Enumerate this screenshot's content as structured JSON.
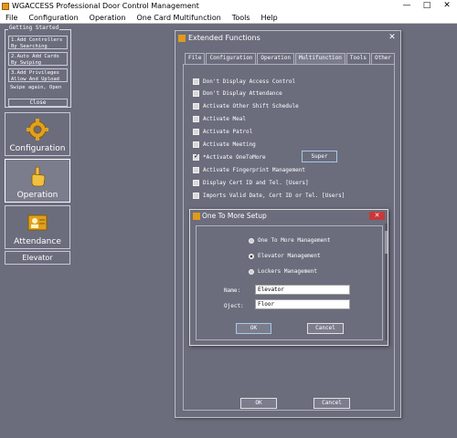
{
  "window": {
    "title": "WGACCESS Professional Door Control Management",
    "minimize": "—",
    "maximize": "□",
    "close": "✕"
  },
  "menu": [
    "File",
    "Configuration",
    "Operation",
    "One Card Multifunction",
    "Tools",
    "Help"
  ],
  "getting_started": {
    "legend": "Getting Started",
    "items": [
      "1.Add Controllers By Searching",
      "2.Auto Add Cards By Swiping",
      "3.Add Privileges Allow And Upload",
      "Swipe again, Open"
    ],
    "close": "Close"
  },
  "nav": [
    {
      "label": "Configuration",
      "icon": "gear-icon"
    },
    {
      "label": "Operation",
      "icon": "hand-pointer-icon"
    },
    {
      "label": "Attendance",
      "icon": "attendance-icon"
    },
    {
      "label": "Elevator"
    }
  ],
  "extended": {
    "title": "Extended Functions",
    "close": "✕",
    "tabs": [
      "File",
      "Configuration",
      "Operation",
      "Multifunction",
      "Tools",
      "Other"
    ],
    "active_tab": "Multifunction",
    "options": [
      {
        "label": "Don't Display Access Control",
        "checked": false
      },
      {
        "label": "Don't Display Attendance",
        "checked": false
      },
      {
        "label": "Activate Other Shift Schedule",
        "checked": false
      },
      {
        "label": "Activate Meal",
        "checked": false
      },
      {
        "label": "Activate Patrol",
        "checked": false
      },
      {
        "label": "Activate Meeting",
        "checked": false
      },
      {
        "label": "*Activate OneToMore",
        "checked": true
      },
      {
        "label": "Activate Fingerprint Management",
        "checked": false
      },
      {
        "label": "Display Cert ID and Tel. [Users]",
        "checked": false
      },
      {
        "label": "Imports Valid Date,  Cert ID or Tel. [Users]",
        "checked": false
      }
    ],
    "super_button": "Super",
    "ok": "OK",
    "cancel": "Cancel"
  },
  "one_to_more": {
    "title": "One To More Setup",
    "close": "✕",
    "radios": [
      {
        "label": "One To More Management",
        "selected": false
      },
      {
        "label": "Elevator  Management",
        "selected": true
      },
      {
        "label": "Lockers  Management",
        "selected": false
      }
    ],
    "name_label": "Name:",
    "name_value": "Elevator",
    "oject_label": "Oject:",
    "oject_value": "Floor",
    "ok": "OK",
    "cancel": "Cancel"
  }
}
